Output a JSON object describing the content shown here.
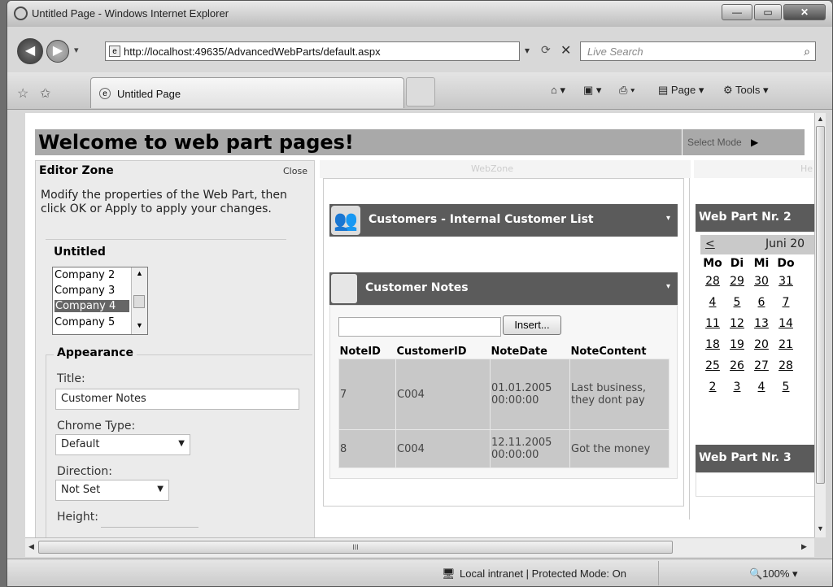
{
  "window": {
    "title": "Untitled Page - Windows Internet Explorer"
  },
  "address": {
    "url": "http://localhost:49635/AdvancedWebParts/default.aspx",
    "search_placeholder": "Live Search"
  },
  "tab": {
    "label": "Untitled Page"
  },
  "commandbar": {
    "page": "Page",
    "tools": "Tools"
  },
  "page": {
    "header": "Welcome to web part pages!",
    "select_mode": "Select Mode",
    "webzone_label": "WebZone",
    "he_label": "He"
  },
  "editor": {
    "title": "Editor Zone",
    "close": "Close",
    "instructions": "Modify the properties of the Web Part, then click OK or Apply to apply your changes.",
    "untitled_label": "Untitled",
    "companies": [
      "Company 2",
      "Company 3",
      "Company 4",
      "Company 5"
    ],
    "selected_company": "Company 4",
    "appearance_label": "Appearance",
    "title_label": "Title:",
    "title_value": "Customer Notes",
    "chrome_label": "Chrome Type:",
    "chrome_value": "Default",
    "direction_label": "Direction:",
    "direction_value": "Not Set",
    "height_label": "Height:"
  },
  "customers_part": {
    "title": "Customers - Internal Customer List"
  },
  "notes_part": {
    "title": "Customer Notes",
    "insert": "Insert...",
    "columns": [
      "NoteID",
      "CustomerID",
      "NoteDate",
      "NoteContent"
    ],
    "rows": [
      [
        "7",
        "C004",
        "01.01.2005 00:00:00",
        "Last business, they dont pay"
      ],
      [
        "8",
        "C004",
        "12.11.2005 00:00:00",
        "Got the money"
      ]
    ]
  },
  "calendar_part": {
    "title": "Web Part Nr. 2",
    "prev": "<",
    "month": "Juni 20",
    "days": [
      "Mo",
      "Di",
      "Mi",
      "Do"
    ],
    "weeks": [
      [
        "28",
        "29",
        "30",
        "31"
      ],
      [
        "4",
        "5",
        "6",
        "7"
      ],
      [
        "11",
        "12",
        "13",
        "14"
      ],
      [
        "18",
        "19",
        "20",
        "21"
      ],
      [
        "25",
        "26",
        "27",
        "28"
      ],
      [
        "2",
        "3",
        "4",
        "5"
      ]
    ]
  },
  "part3": {
    "title": "Web Part Nr. 3"
  },
  "status": {
    "zone": "Local intranet | Protected Mode: On",
    "zoom": "100%"
  }
}
